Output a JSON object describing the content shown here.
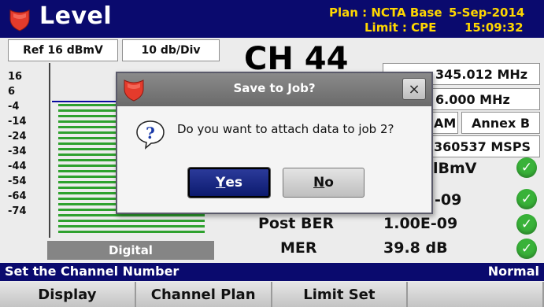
{
  "header": {
    "title": "Level",
    "plan_line": "Plan : NCTA Base",
    "limit_line": "Limit : CPE",
    "date": "5-Sep-2014",
    "time": "15:09:32"
  },
  "graph": {
    "ref_level": "Ref 16 dBmV",
    "scale": "10 db/Div",
    "y_ticks": [
      "16",
      "6",
      "-4",
      "-14",
      "-24",
      "-34",
      "-44",
      "-54",
      "-64",
      "-74"
    ],
    "footer_label": "Digital"
  },
  "channel": {
    "label": "CH 44",
    "frequency_partial": "345.012 MHz",
    "bandwidth_partial": "6.000 MHz",
    "modulation_partial": "AM",
    "annex": "Annex B",
    "symbol_rate_partial": "360537 MSPS"
  },
  "measurements": [
    {
      "label": "",
      "value": "lBmV"
    },
    {
      "label": "",
      "value": "-09"
    },
    {
      "label": "Post BER",
      "value": "1.00E-09"
    },
    {
      "label": "MER",
      "value": "39.8 dB"
    }
  ],
  "status_bar": {
    "message": "Set the Channel Number",
    "mode": "Normal"
  },
  "softkeys": [
    "Display",
    "Channel Plan",
    "Limit Set",
    ""
  ],
  "dialog": {
    "title": "Save to Job?",
    "message": "Do you want to attach data to job 2?",
    "close_glyph": "×",
    "yes_accel": "Y",
    "yes_rest": "es",
    "no_accel": "N",
    "no_rest": "o"
  },
  "colors": {
    "header_bg": "#0a0a6e",
    "header_accent": "#ffd700",
    "bar_green": "#2ea12e",
    "reference_line": "#0a0a9e",
    "pass_green": "#39b239",
    "dialog_titlebar": "#7a7a7a"
  },
  "icons": {
    "logo": "red-shield-icon",
    "question": "question-speech-bubble-icon",
    "pass": "check-circle-icon"
  }
}
